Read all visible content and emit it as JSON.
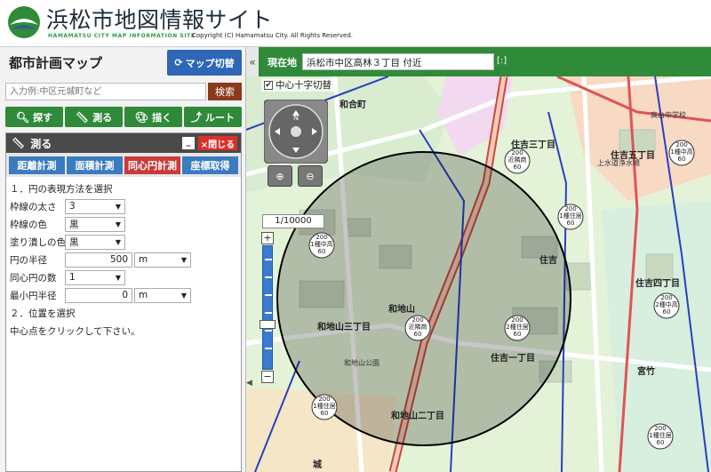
{
  "header": {
    "site_title": "浜松市地図情報サイト",
    "site_title_en": "HAMAMATSU CITY MAP INFORMATION SITE",
    "copyright": "Copyright (C) Hamamatsu City. All Rights Reserved."
  },
  "panel": {
    "title": "都市計画マップ",
    "switch_label": "マップ切替",
    "search_placeholder": "入力例:中区元城町など",
    "search_button": "検索",
    "tools": [
      {
        "label": "探す",
        "icon": "search-icon"
      },
      {
        "label": "測る",
        "icon": "ruler-icon"
      },
      {
        "label": "描く",
        "icon": "palette-icon"
      },
      {
        "label": "ルート",
        "icon": "route-icon"
      }
    ]
  },
  "measure": {
    "title": "測る",
    "minimize": "_",
    "close_label": "×閉じる",
    "tabs": [
      {
        "label": "距離計測",
        "active": false
      },
      {
        "label": "面積計測",
        "active": false
      },
      {
        "label": "同心円計測",
        "active": true
      },
      {
        "label": "座標取得",
        "active": false
      }
    ],
    "step1": "１．円の表現方法を選択",
    "line_width_label": "枠線の太さ",
    "line_width_value": "3",
    "line_color_label": "枠線の色",
    "line_color_value": "黒",
    "fill_color_label": "塗り潰しの色",
    "fill_color_value": "黒",
    "radius_label": "円の半径",
    "radius_value": "500",
    "radius_unit": "m",
    "count_label": "同心円の数",
    "count_value": "1",
    "min_radius_label": "最小円半径",
    "min_radius_value": "0",
    "min_radius_unit": "m",
    "step2": "２．位置を選択",
    "instruction": "中心点をクリックして下さい。"
  },
  "mapbar": {
    "collapse": "«",
    "location_label": "現在地",
    "location_value": "浜松市中区高林３丁目 付近",
    "expand": "[:]"
  },
  "map": {
    "crosshair_label": "中心十字切替",
    "crosshair_checked": "✔",
    "scale": "1/10000",
    "compass": "N",
    "labels": {
      "wagocho": "和合町",
      "sumiyoshi3": "住吉三丁目",
      "sumiyoshi5": "住吉五丁目",
      "sumiyoshi4": "住吉四丁目",
      "sumiyoshi1": "住吉一丁目",
      "wajiyama3": "和地山三丁目",
      "wajiyama": "和地山",
      "wajiyama_park": "和地山公園",
      "sumiyoshi": "住吉",
      "miyatake": "宮竹",
      "josui": "上水道浄水場",
      "takadai": "高台中学校",
      "jichi": "和地山二丁目",
      "castle": "城"
    },
    "zones": {
      "z1": "1種中高",
      "z2": "2種中高",
      "z3": "1種住居",
      "z4": "2種住居",
      "z5": "近隣商",
      "ratio1": "200",
      "ratio2": "60"
    }
  }
}
